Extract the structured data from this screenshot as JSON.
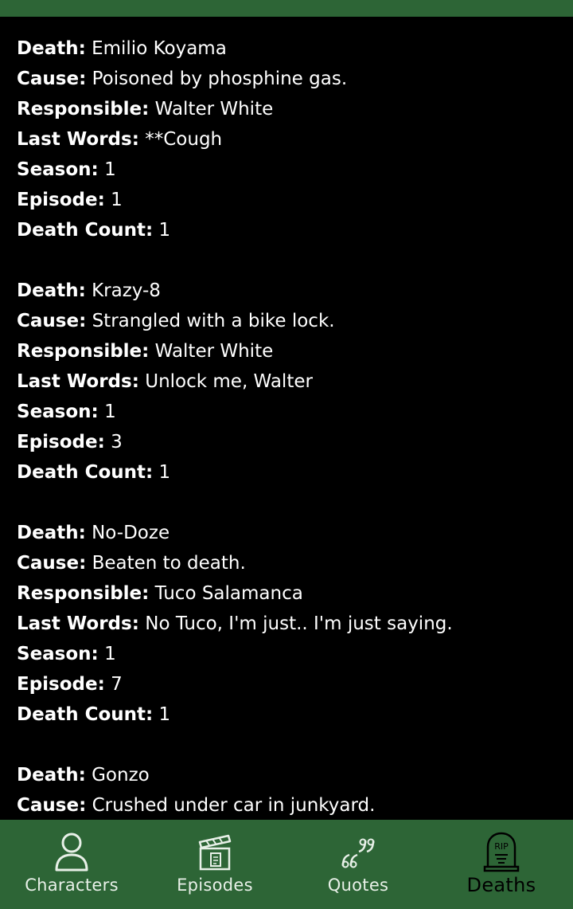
{
  "labels": {
    "death": "Death:",
    "cause": "Cause:",
    "responsible": "Responsible:",
    "last_words": "Last Words:",
    "season": "Season:",
    "episode": "Episode:",
    "death_count": "Death Count:"
  },
  "deaths": [
    {
      "death": "Emilio Koyama",
      "cause": "Poisoned by phosphine gas.",
      "responsible": "Walter White",
      "last_words": "**Cough",
      "season": "1",
      "episode": "1",
      "death_count": "1"
    },
    {
      "death": "Krazy-8",
      "cause": "Strangled with a bike lock.",
      "responsible": "Walter White",
      "last_words": "Unlock me, Walter",
      "season": "1",
      "episode": "3",
      "death_count": "1"
    },
    {
      "death": "No-Doze",
      "cause": "Beaten to death.",
      "responsible": "Tuco Salamanca",
      "last_words": "No Tuco, I'm just.. I'm just saying.",
      "season": "1",
      "episode": "7",
      "death_count": "1"
    },
    {
      "death": "Gonzo",
      "cause": "Crushed under car in junkyard."
    }
  ],
  "nav": {
    "items": [
      {
        "label": "Characters",
        "icon": "person-icon"
      },
      {
        "label": "Episodes",
        "icon": "clapperboard-icon"
      },
      {
        "label": "Quotes",
        "icon": "quote-icon"
      },
      {
        "label": "Deaths",
        "icon": "tombstone-icon",
        "icon_text": "RIP",
        "active": true
      }
    ]
  },
  "colors": {
    "bar": "#2d6536",
    "background": "#000000",
    "text": "#ffffff",
    "active_nav_label": "#000000"
  }
}
